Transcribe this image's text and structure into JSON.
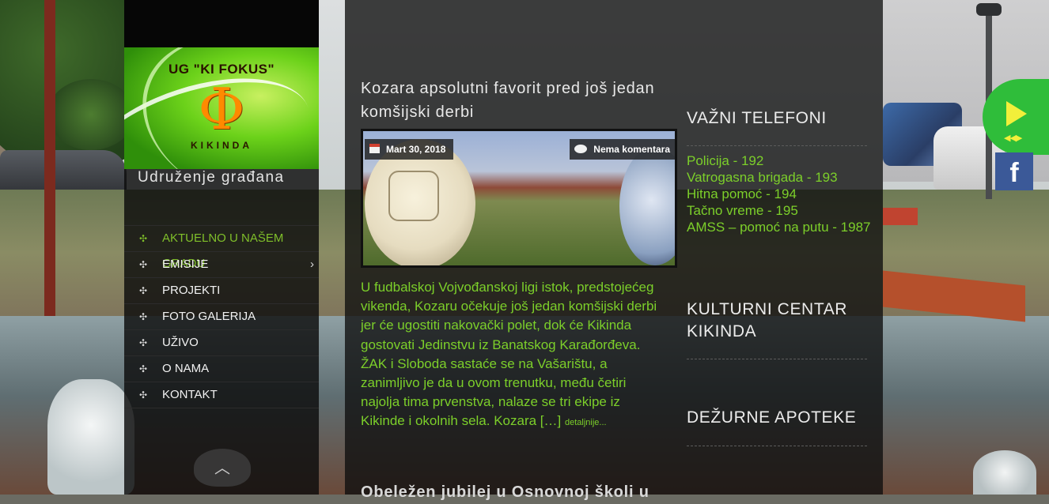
{
  "site": {
    "logo_title": "UG \"KI FOKUS\"",
    "logo_symbol": "Φ",
    "logo_city": "KIKINDA",
    "tagline": "Udruženje građana"
  },
  "menu": {
    "items": [
      {
        "label": "AKTUELNO U NAŠEM GRADU",
        "active": true
      },
      {
        "label": "EMISIJE",
        "has_submenu": true
      },
      {
        "label": "PROJEKTI"
      },
      {
        "label": "FOTO GALERIJA"
      },
      {
        "label": "UŽIVO"
      },
      {
        "label": "O NAMA"
      },
      {
        "label": "KONTAKT"
      }
    ],
    "bullet": "✣",
    "submenu_chevron": "›"
  },
  "post": {
    "title": "Kozara apsolutni favorit pred još jedan komšijski derbi",
    "date": "Mart 30, 2018",
    "comments": "Nema komentara",
    "excerpt": "U fudbalskoj Vojvođanskoj ligi istok, predstojećeg vikenda, Kozaru očekuje još jedan komšijski derbi jer će ugostiti nakovački polet, dok će Kikinda gostovati Jedinstvu iz Banatskog Karađorđeva. ŽAK i Sloboda sastaće se na Vašarištu, a zanimljivo je da u ovom trenutku, među četiri najolja tima prvenstva, nalaze se tri ekipe iz Kikinde i okolnih sela. Kozara […]",
    "more_link": "detaljnije..."
  },
  "next_post": {
    "title": "Obeležen jubilej u Osnovnoj školi u"
  },
  "widgets": {
    "phones_title": "VAŽNI TELEFONI",
    "phones": [
      "Policija - 192",
      "Vatrogasna brigada - 193",
      "Hitna pomoć - 194",
      "Tačno vreme - 195",
      "AMSS – pomoć na putu - 1987"
    ],
    "culture_title": "KULTURNI CENTAR KIKINDA",
    "pharmacy_title": "DEŽURNE APOTEKE"
  },
  "floating": {
    "player_sub": "◀◀▶",
    "facebook_label": "f"
  },
  "colors": {
    "accent_green": "#7ccf2a",
    "facebook_blue": "#3b5998",
    "player_green": "#2fbd3a"
  },
  "icons": [
    "calendar-icon",
    "comment-bubble-icon",
    "play-icon",
    "facebook-icon",
    "chevron-up-icon",
    "chevron-right-icon"
  ]
}
